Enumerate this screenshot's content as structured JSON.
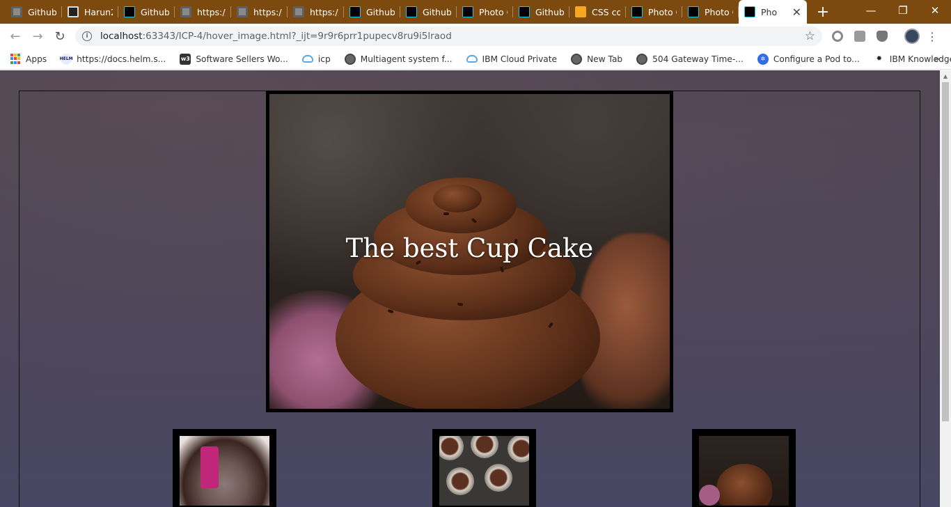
{
  "browser": {
    "tabs": [
      {
        "title": "Github",
        "icon": "globe-icon"
      },
      {
        "title": "Harun2",
        "icon": "github-icon"
      },
      {
        "title": "Github",
        "icon": "webstorm-icon"
      },
      {
        "title": "https://",
        "icon": "globe-icon"
      },
      {
        "title": "https://",
        "icon": "globe-icon"
      },
      {
        "title": "https://",
        "icon": "globe-icon"
      },
      {
        "title": "Github",
        "icon": "webstorm-icon"
      },
      {
        "title": "Github",
        "icon": "webstorm-icon"
      },
      {
        "title": "Photo C",
        "icon": "webstorm-icon"
      },
      {
        "title": "Github",
        "icon": "webstorm-icon"
      },
      {
        "title": "CSS col",
        "icon": "r-icon"
      },
      {
        "title": "Photo C",
        "icon": "webstorm-icon"
      },
      {
        "title": "Photo C",
        "icon": "webstorm-icon"
      }
    ],
    "active_tab": {
      "title": "Pho",
      "icon": "webstorm-icon",
      "close": "✕"
    },
    "new_tab": "+",
    "window_controls": {
      "minimize": "—",
      "restore": "❐",
      "close": "✕"
    },
    "url_host": "localhost",
    "url_path": ":63343/ICP-4/hover_image.html?_ijt=9r9r6prr1pupecv8ru9i5lraod",
    "bookmarks": [
      {
        "label": "Apps",
        "icon": "apps-icon"
      },
      {
        "label": "https://docs.helm.s...",
        "icon": "helm-icon"
      },
      {
        "label": "Software Sellers Wo...",
        "icon": "w3-icon"
      },
      {
        "label": "icp",
        "icon": "cloud-icon"
      },
      {
        "label": "Multiagent system f...",
        "icon": "globe-icon"
      },
      {
        "label": "IBM Cloud Private",
        "icon": "cloud-icon"
      },
      {
        "label": "New Tab",
        "icon": "globe-icon"
      },
      {
        "label": "504 Gateway Time-...",
        "icon": "globe-icon"
      },
      {
        "label": "Configure a Pod to...",
        "icon": "kubernetes-icon"
      },
      {
        "label": "IBM Knowledge Ce...",
        "icon": "ibm-icon"
      }
    ],
    "bookmarks_more": "»"
  },
  "page": {
    "hero_caption": "The best Cup Cake"
  },
  "colors": {
    "tab_strip": "#7c4a0e",
    "page_bg": "#4d4457",
    "frame_border": "#000000"
  }
}
